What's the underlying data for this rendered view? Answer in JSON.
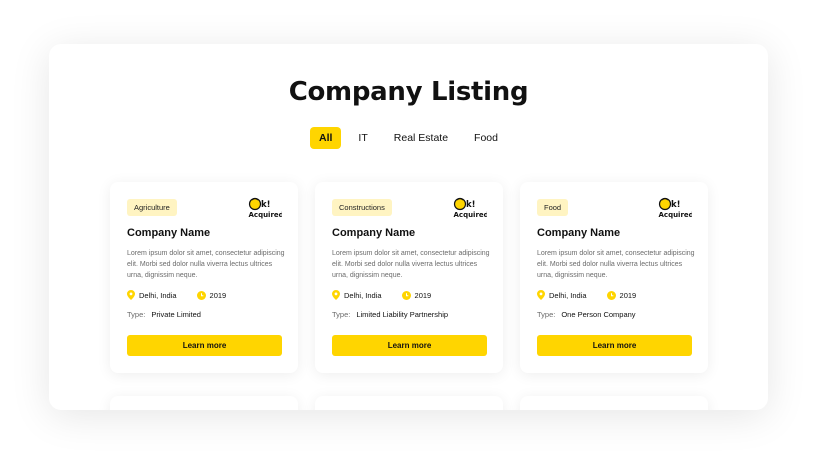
{
  "header": {
    "title": "Company Listing"
  },
  "filters": {
    "tabs": [
      {
        "label": "All",
        "active": true
      },
      {
        "label": "IT",
        "active": false
      },
      {
        "label": "Real Estate",
        "active": false
      },
      {
        "label": "Food",
        "active": false
      }
    ]
  },
  "brand": {
    "accent": "#FFD500",
    "tag_bg": "#FFF4C2",
    "logo_text_top": "k!",
    "logo_text_bottom": "Acquired"
  },
  "cards": [
    {
      "category": "Agriculture",
      "name": "Company Name",
      "description": "Lorem ipsum dolor sit amet, consectetur adipiscing elit. Morbi sed dolor nulla viverra lectus ultrices urna, dignissim neque.",
      "location": "Delhi, India",
      "year": "2019",
      "type_label": "Type:",
      "type_value": "Private Limited",
      "cta": "Learn more"
    },
    {
      "category": "Constructions",
      "name": "Company Name",
      "description": "Lorem ipsum dolor sit amet, consectetur adipiscing elit. Morbi sed dolor nulla viverra lectus ultrices urna, dignissim neque.",
      "location": "Delhi, India",
      "year": "2019",
      "type_label": "Type:",
      "type_value": "Limited Liability Partnership",
      "cta": "Learn more"
    },
    {
      "category": "Food",
      "name": "Company Name",
      "description": "Lorem ipsum dolor sit amet, consectetur adipiscing elit. Morbi sed dolor nulla viverra lectus ultrices urna, dignissim neque.",
      "location": "Delhi, India",
      "year": "2019",
      "type_label": "Type:",
      "type_value": "One Person Company",
      "cta": "Learn more"
    }
  ],
  "icons": {
    "location": "location-pin-icon",
    "year": "calendar-icon"
  }
}
